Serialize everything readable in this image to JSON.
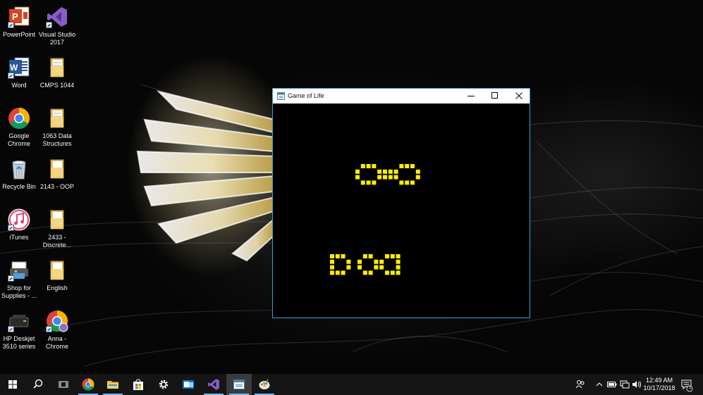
{
  "desktop": {
    "icons": [
      {
        "label": "PowerPoint",
        "icon": "powerpoint-icon"
      },
      {
        "label": "Visual Studio 2017",
        "icon": "visual-studio-icon"
      },
      {
        "label": "Word",
        "icon": "word-icon"
      },
      {
        "label": "CMPS 1044",
        "icon": "folder-icon"
      },
      {
        "label": "Google Chrome",
        "icon": "chrome-icon"
      },
      {
        "label": "1063 Data Structures",
        "icon": "folder-icon"
      },
      {
        "label": "Recycle Bin",
        "icon": "recycle-bin-icon"
      },
      {
        "label": "2143 - OOP",
        "icon": "folder-icon"
      },
      {
        "label": "iTunes",
        "icon": "itunes-icon"
      },
      {
        "label": "2433 - Discrete...",
        "icon": "folder-icon"
      },
      {
        "label": "Shop for Supplies - ...",
        "icon": "printer-shop-icon"
      },
      {
        "label": "English",
        "icon": "folder-icon"
      },
      {
        "label": "HP Deskjet 3510 series",
        "icon": "printer-icon"
      },
      {
        "label": "Anna - Chrome",
        "icon": "chrome-profile-icon"
      }
    ]
  },
  "window": {
    "title": "Game of Life",
    "cell_color": "#ffee00",
    "border_color": "#3a9fc9",
    "controls": [
      "minimize",
      "maximize",
      "close"
    ]
  },
  "taskbar": {
    "items": [
      "start",
      "search",
      "task-view",
      "chrome",
      "file-explorer",
      "store",
      "settings",
      "outlook",
      "visual-studio",
      "game-of-life",
      "paint"
    ],
    "time": "12:49 AM",
    "date": "10/17/2018",
    "notification_count": "1",
    "accent": "#76b9ed"
  }
}
